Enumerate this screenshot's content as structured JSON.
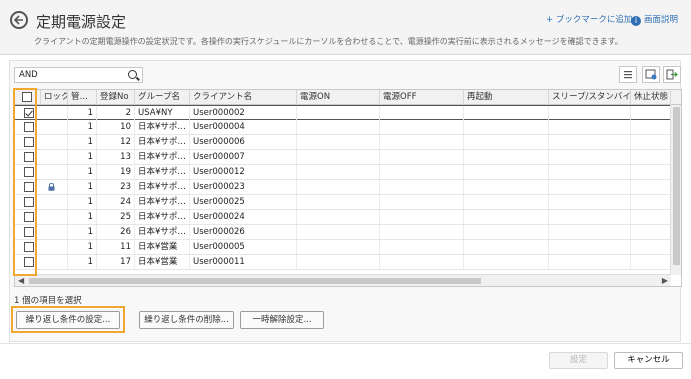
{
  "header": {
    "title": "定期電源設定",
    "description": "クライアントの定期電源操作の設定状況です。各操作の実行スケジュールにカーソルを合わせることで、電源操作の実行前に表示されるメッセージを確認できます。",
    "bookmark_label": "+ ブックマークに追加",
    "help_label": "画面説明",
    "help_icon_glyph": "i"
  },
  "search": {
    "value": "AND"
  },
  "table": {
    "columns": [
      "ロック",
      "管…",
      "登録No",
      "グループ名",
      "クライアント名",
      "電源ON",
      "電源OFF",
      "再起動",
      "スリープ/スタンバイ",
      "休止状態"
    ],
    "rows": [
      {
        "checked": true,
        "lock": false,
        "kan": "1",
        "no": "2",
        "group": "USA¥NY",
        "client": "User000002"
      },
      {
        "checked": false,
        "lock": false,
        "kan": "1",
        "no": "10",
        "group": "日本¥サポ…",
        "client": "User000004"
      },
      {
        "checked": false,
        "lock": false,
        "kan": "1",
        "no": "12",
        "group": "日本¥サポ…",
        "client": "User000006"
      },
      {
        "checked": false,
        "lock": false,
        "kan": "1",
        "no": "13",
        "group": "日本¥サポ…",
        "client": "User000007"
      },
      {
        "checked": false,
        "lock": false,
        "kan": "1",
        "no": "19",
        "group": "日本¥サポ…",
        "client": "User000012"
      },
      {
        "checked": false,
        "lock": true,
        "kan": "1",
        "no": "23",
        "group": "日本¥サポ…",
        "client": "User000023"
      },
      {
        "checked": false,
        "lock": false,
        "kan": "1",
        "no": "24",
        "group": "日本¥サポ…",
        "client": "User000025"
      },
      {
        "checked": false,
        "lock": false,
        "kan": "1",
        "no": "25",
        "group": "日本¥サポ…",
        "client": "User000024"
      },
      {
        "checked": false,
        "lock": false,
        "kan": "1",
        "no": "26",
        "group": "日本¥サポ…",
        "client": "User000026"
      },
      {
        "checked": false,
        "lock": false,
        "kan": "1",
        "no": "11",
        "group": "日本¥営業",
        "client": "User000005"
      },
      {
        "checked": false,
        "lock": false,
        "kan": "1",
        "no": "17",
        "group": "日本¥営業",
        "client": "User000011"
      }
    ]
  },
  "selection": {
    "count_text": "1 個の項目を選択"
  },
  "actions": {
    "repeat_set": "繰り返し条件の設定...",
    "repeat_delete": "繰り返し条件の削除...",
    "temp_release": "一時解除設定..."
  },
  "footer": {
    "ok": "設定",
    "cancel": "キャンセル"
  },
  "colors": {
    "accent": "#f0a830",
    "link": "#2f6fb4"
  }
}
